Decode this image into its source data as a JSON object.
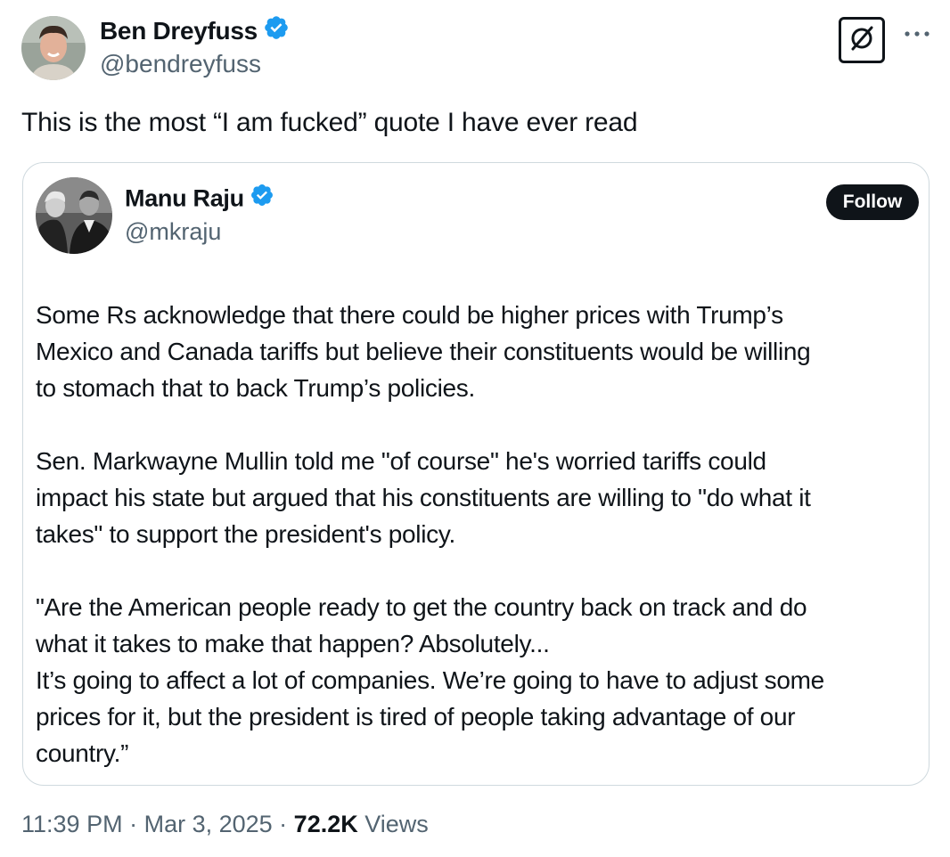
{
  "tweet": {
    "author": {
      "name": "Ben Dreyfuss",
      "handle": "@bendreyfuss"
    },
    "text": "This is the most “I am fucked” quote I have ever read",
    "quoted": {
      "author": {
        "name": "Manu Raju",
        "handle": "@mkraju"
      },
      "follow_label": "Follow",
      "paragraphs": [
        {
          "lines": [
            "Some Rs acknowledge that there could be higher prices with Trump’s",
            "Mexico and Canada tariffs but believe their constituents would be willing",
            "to stomach that to back Trump’s policies."
          ]
        },
        {
          "lines": [
            "Sen. Markwayne Mullin told me \"of course\" he's worried tariffs could",
            "impact his state but argued that his constituents are willing to \"do what it",
            "takes\" to support the president's policy."
          ]
        },
        {
          "lines": [
            "\"Are the American people ready to get the country back on track and do",
            "what it takes to make that happen? Absolutely...",
            "It’s going to affect a lot of companies. We’re going to have to adjust some",
            "prices for it, but the president is tired of people taking advantage of our",
            "country.”"
          ]
        }
      ]
    },
    "meta": {
      "time": "11:39 PM",
      "separator": " · ",
      "date": "Mar 3, 2025",
      "views_count": "72.2K",
      "views_label": " Views"
    }
  },
  "icons": {
    "verified": "verified-badge-icon",
    "grok": "grok-icon",
    "more": "more-options-icon"
  },
  "colors": {
    "text_primary": "#0f1419",
    "text_secondary": "#536471",
    "verified_blue": "#1d9bf0",
    "border": "#cfd9de",
    "follow_bg": "#0f1419"
  }
}
